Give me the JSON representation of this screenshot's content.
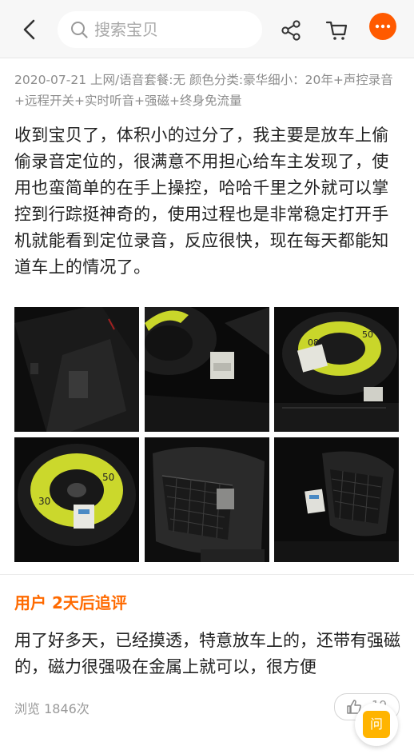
{
  "header": {
    "search_placeholder": "搜索宝贝",
    "back_icon": "chevron-left-icon",
    "search_icon": "magnifier-icon",
    "share_icon": "share-icon",
    "cart_icon": "cart-icon",
    "more_icon": "more-dots-icon",
    "more_color": "#ff5a00"
  },
  "review": {
    "meta": "2020-07-21 上网/语音套餐:无 颜色分类:豪华细小：20年+声控录音+远程开关+实时听音+强磁+终身免流量",
    "text": "收到宝贝了，体积小的过分了，我主要是放车上偷偷录音定位的，很满意不用担心给车主发现了，使用也蛮简单的在手上操控，哈哈千里之外就可以掌控到行踪挺神奇的，使用过程也是非常稳定打开手机就能看到定位录音，反应很快，现在每天都能知道车上的情况了。",
    "photos": [
      {
        "label": "car-trunk-side-panel"
      },
      {
        "label": "spare-tire-with-device"
      },
      {
        "label": "spare-tire-with-device-box"
      },
      {
        "label": "spare-tire-yellow-50"
      },
      {
        "label": "trunk-net-pocket"
      },
      {
        "label": "trunk-net-pocket-with-box"
      }
    ]
  },
  "followup": {
    "title": "用户 2天后追评",
    "text": "用了好多天，已经摸透，特意放车上的，还带有强磁的，磁力很强吸在金属上就可以，很方便"
  },
  "footer": {
    "views": "浏览 1846次",
    "like_count": "19",
    "like_icon": "thumbs-up-icon",
    "ask_label": "问",
    "accent_color": "#ff6a00"
  }
}
